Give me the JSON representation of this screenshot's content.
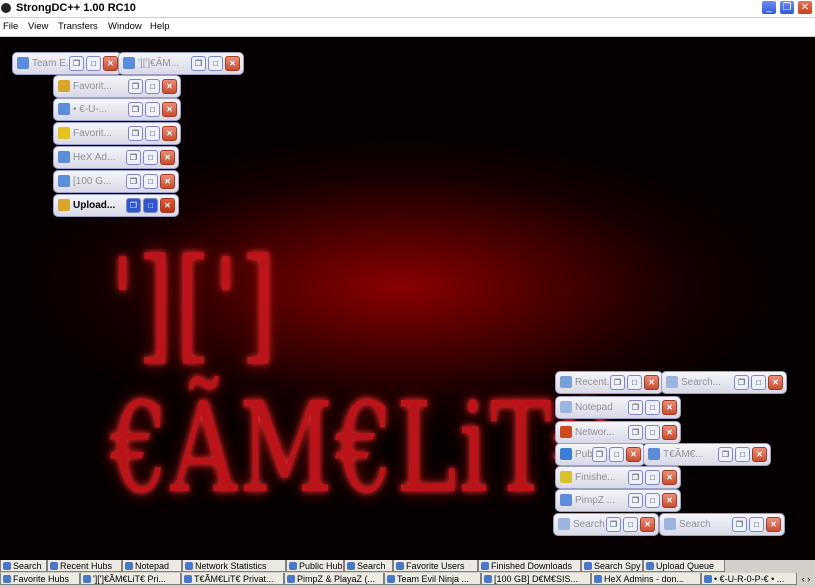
{
  "window": {
    "title": "StrongDC++ 1.00 RC10"
  },
  "title_buttons": {
    "minimize": "_",
    "restore": "❐",
    "close": "✕"
  },
  "menu": [
    "File",
    "View",
    "Transfers",
    "Window",
    "Help"
  ],
  "logo_text": "'][']€ÃM€LiT€",
  "minimized_windows": [
    {
      "label": "Team E...",
      "icon_color": "#5b8dd8"
    },
    {
      "label": "'][']€ÃM...",
      "icon_color": "#5b8dd8"
    },
    {
      "label": "Favorit...",
      "icon_color": "#d8a62e"
    },
    {
      "label": "• €-U-...",
      "icon_color": "#5b8dd8"
    },
    {
      "label": "Favorit...",
      "icon_color": "#e3c320"
    },
    {
      "label": "HeX Ad...",
      "icon_color": "#5b8dd8"
    },
    {
      "label": "[100 G...",
      "icon_color": "#5b8dd8"
    },
    {
      "label": "Upload...",
      "icon_color": "#d8a62e",
      "active": true
    },
    {
      "label": "Recent...",
      "icon_color": "#7a9fd6"
    },
    {
      "label": "Search...",
      "icon_color": "#9db5de"
    },
    {
      "label": "Notepad",
      "icon_color": "#9db5de"
    },
    {
      "label": "Networ...",
      "icon_color": "#d04a1f"
    },
    {
      "label": "Public ...",
      "icon_color": "#3a7fd6"
    },
    {
      "label": "T€ÃM€...",
      "icon_color": "#5b8dd8"
    },
    {
      "label": "Finishe...",
      "icon_color": "#d8c12e"
    },
    {
      "label": "PimpZ ...",
      "icon_color": "#5b8dd8"
    },
    {
      "label": "Search",
      "icon_color": "#9db5de"
    },
    {
      "label": "Search",
      "icon_color": "#9db5de"
    }
  ],
  "taskbar_row1": [
    "Search",
    "Recent Hubs",
    "Notepad",
    "Network Statistics",
    "Public Hubs",
    "Search",
    "Favorite Users",
    "Finished Downloads",
    "Search Spy",
    "Upload Queue"
  ],
  "taskbar_row2": [
    "Favorite Hubs",
    "'][']€ÃM€LiT€ Pri...",
    "T€ÃM€LiT€ Privat...",
    "PimpZ & PlayaZ (...",
    "Team Evil Ninja ...",
    "[100 GB] D€M€SIS...",
    "HeX Admins - don...",
    "• €-U-R-0-P-€ • ..."
  ],
  "scroll_arrows": "‹ ›"
}
